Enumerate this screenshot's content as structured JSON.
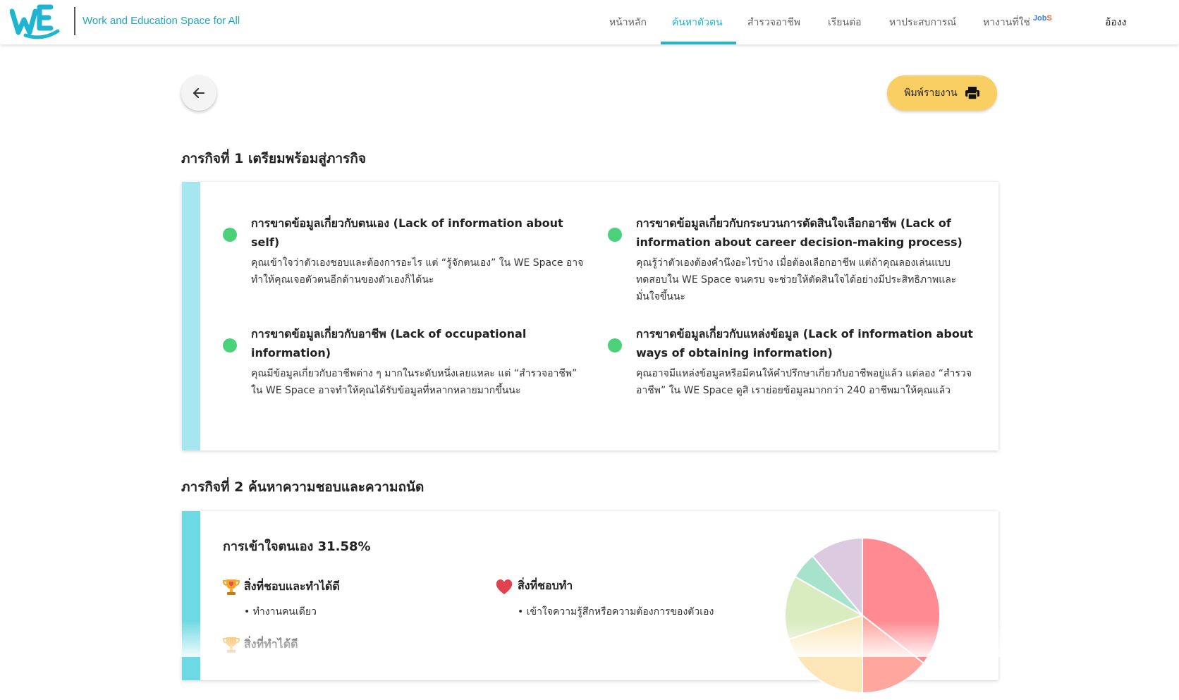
{
  "header": {
    "tagline": "Work and Education Space for All",
    "logo_name": "WE logo",
    "nav": [
      {
        "label": "หน้าหลัก",
        "active": false
      },
      {
        "label": "ค้นหาตัวตน",
        "active": true
      },
      {
        "label": "สำรวจอาชีพ",
        "active": false
      },
      {
        "label": "เรียนต่อ",
        "active": false
      },
      {
        "label": "หาประสบการณ์",
        "active": false
      },
      {
        "label": "หางานที่ใช่",
        "active": false
      }
    ],
    "jobs_badge_a": "Job",
    "jobs_badge_b": "S",
    "user_name": "อ้องง",
    "accent_color": "#1fb5d0"
  },
  "toolbar": {
    "back_icon": "arrow-left-icon",
    "print_label": "พิมพ์รายงาน",
    "print_icon": "printer-icon",
    "print_color": "#f9cf63"
  },
  "mission1": {
    "title": "ภารกิจที่ 1 เตรียมพร้อมสู่ภารกิจ",
    "stripe_color": "#a6e6ee",
    "items": [
      {
        "title": "การขาดข้อมูลเกี่ยวกับตนเอง (Lack of information about self)",
        "desc": "คุณเข้าใจว่าตัวเองชอบและต้องการอะไร แต่ “รู้จักตนเอง” ใน WE Space อาจทำให้คุณเจอตัวตนอีกด้านของตัวเองก็ได้นะ"
      },
      {
        "title": "การขาดข้อมูลเกี่ยวกับกระบวนการตัดสินใจเลือกอาชีพ (Lack of information about career decision-making process)",
        "desc": "คุณรู้ว่าตัวเองต้องคำนึงอะไรบ้าง เมื่อต้องเลือกอาชีพ แต่ถ้าคุณลองเล่นแบบทดสอบใน WE Space จนครบ จะช่วยให้ตัดสินใจได้อย่างมีประสิทธิภาพและมั่นใจขึ้นนะ"
      },
      {
        "title": "การขาดข้อมูลเกี่ยวกับอาชีพ (Lack of occupational information)",
        "desc": "คุณมีข้อมูลเกี่ยวกับอาชีพต่าง ๆ มากในระดับหนึ่งเลยแหละ แต่ “สำรวจอาชีพ” ใน WE Space อาจทำให้คุณได้รับข้อมูลที่หลากหลายมากขึ้นนะ"
      },
      {
        "title": "การขาดข้อมูลเกี่ยวกับแหล่งข้อมูล (Lack of information about ways of obtaining information)",
        "desc": "คุณอาจมีแหล่งข้อมูลหรือมีคนให้คำปรึกษาเกี่ยวกับอาชีพอยู่แล้ว แต่ลอง “สำรวจอาชีพ” ใน WE Space ดูสิ เราย่อยข้อมูลมากกว่า 240 อาชีพมาให้คุณแล้ว"
      }
    ],
    "dot_color": "#4cd17b"
  },
  "mission2": {
    "title": "ภารกิจที่ 2 ค้นหาความชอบและความถนัด",
    "stripe_color": "#6dd9e3",
    "understanding": "การเข้าใจตนเอง 31.58%",
    "cat_like_good": {
      "label": "สิ่งที่ชอบและทำได้ดี",
      "icon": "trophy-heart-icon",
      "items": [
        "• ทำงานคนเดียว"
      ]
    },
    "cat_like": {
      "label": "สิ่งที่ชอบทำ",
      "icon": "heart-icon",
      "items": [
        "• เข้าใจความรู้สึกหรือความต้องการของตัวเอง"
      ]
    },
    "cat_good": {
      "label": "สิ่งที่ทำได้ดี",
      "icon": "trophy-icon"
    }
  },
  "chart_data": {
    "type": "pie",
    "values": [
      32,
      13,
      18,
      12,
      5,
      10
    ],
    "colors": [
      "#ff8a92",
      "#ffa69e",
      "#fce6b8",
      "#d8ecc0",
      "#a7e3cc",
      "#dccbe0"
    ]
  }
}
